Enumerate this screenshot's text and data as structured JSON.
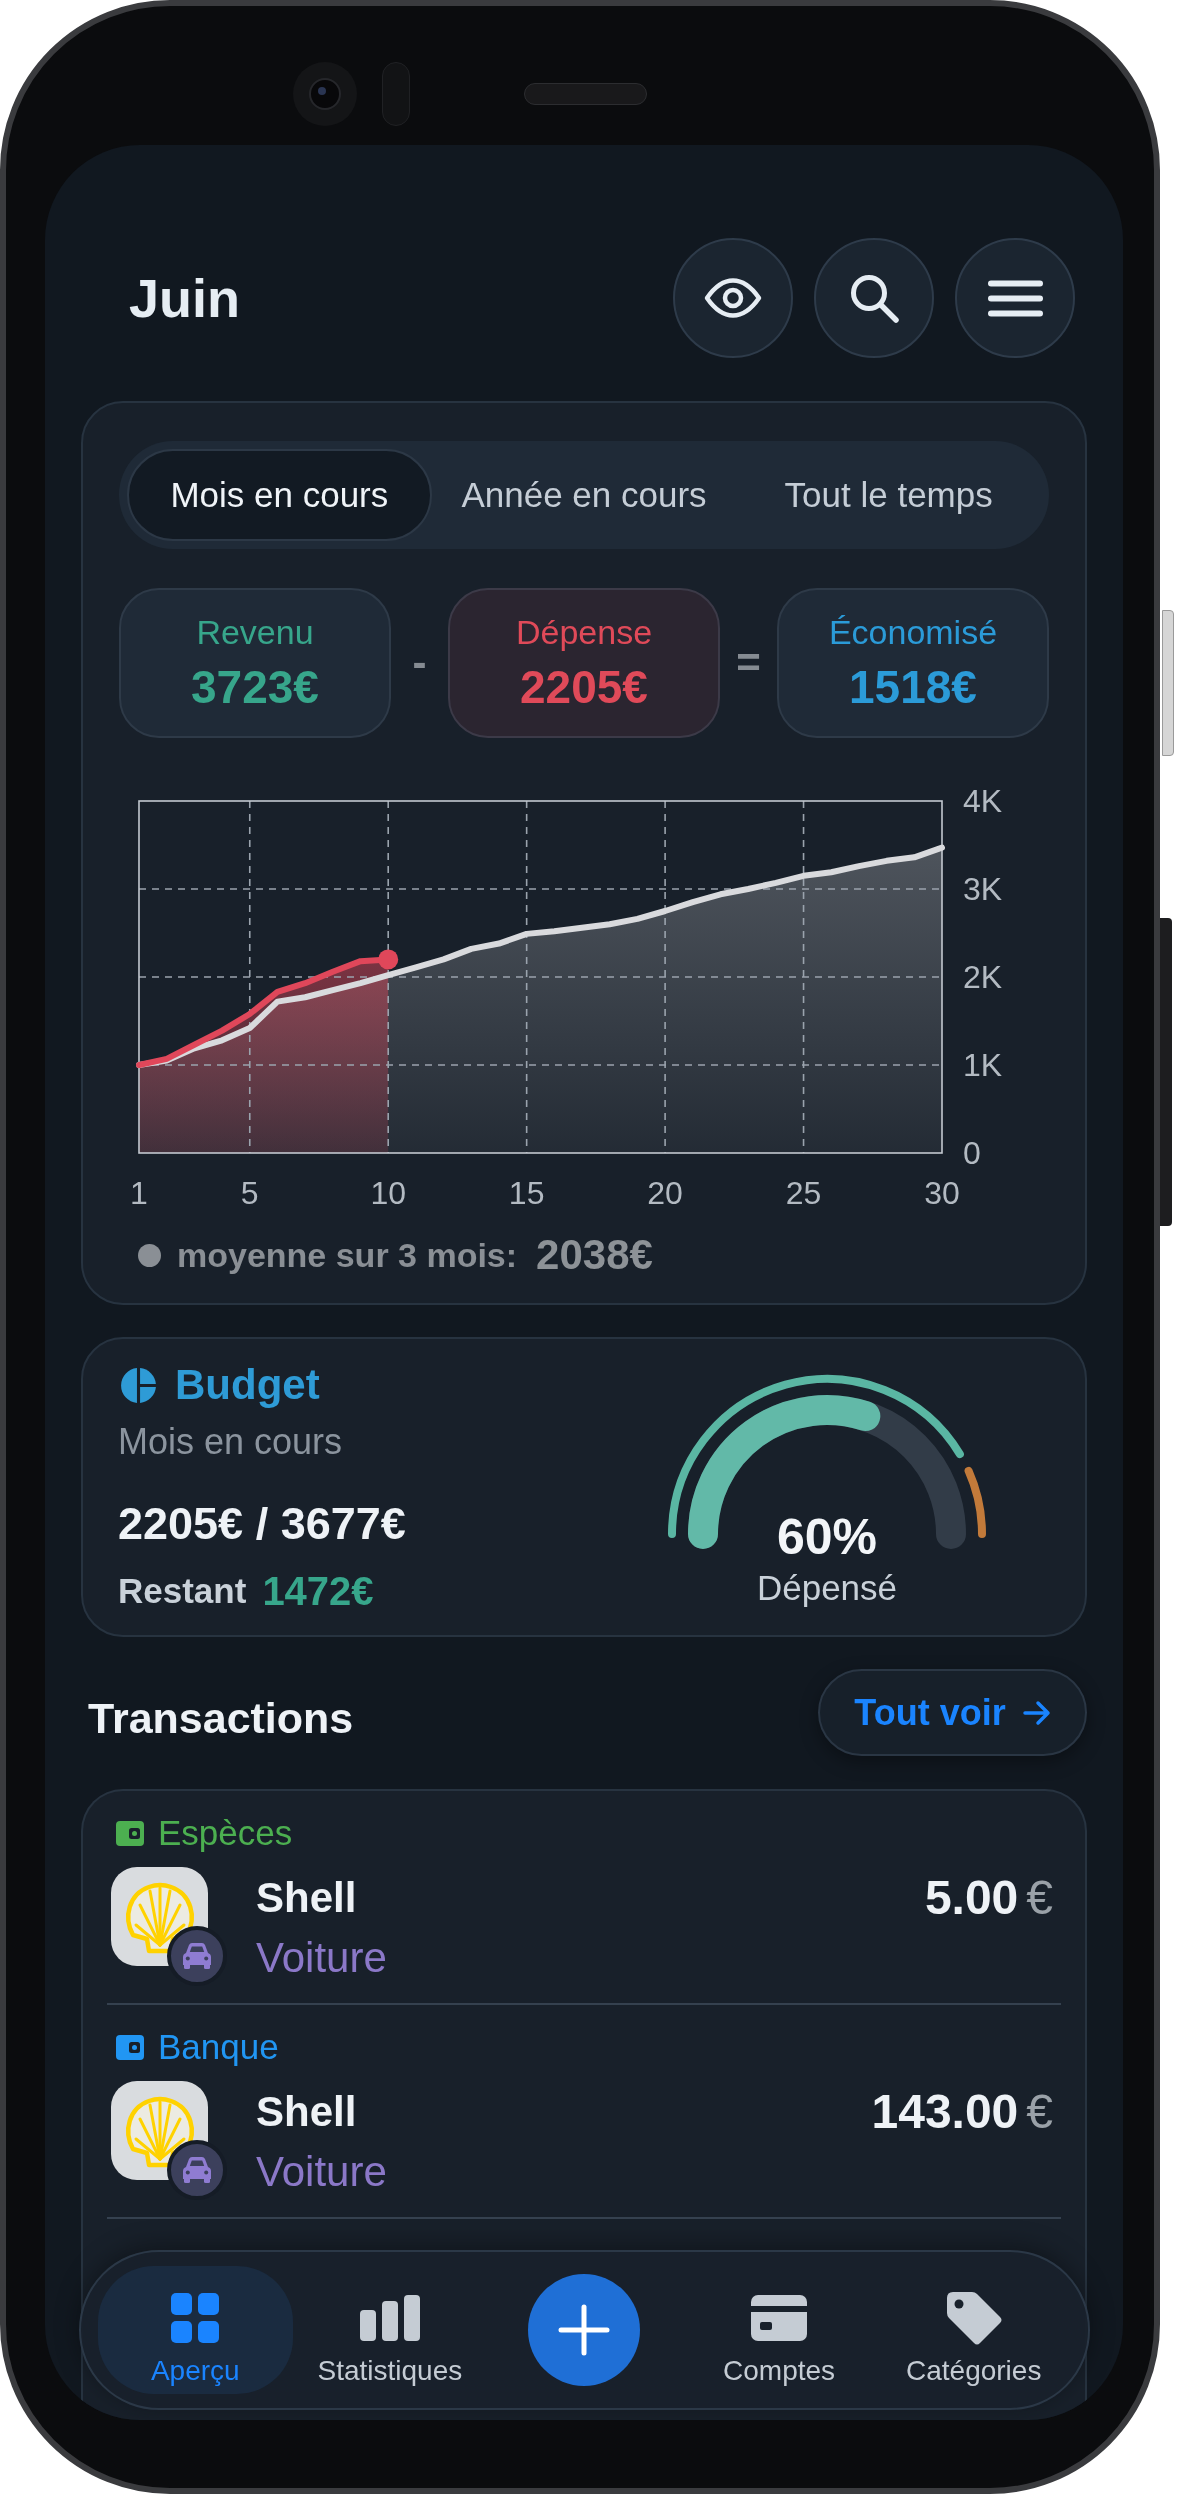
{
  "header": {
    "title": "Juin"
  },
  "overview": {
    "period_tabs": [
      {
        "label": "Mois en cours",
        "selected": true
      },
      {
        "label": "Année en cours",
        "selected": false
      },
      {
        "label": "Tout le temps",
        "selected": false
      }
    ],
    "summary": {
      "cards": [
        {
          "kind": "income",
          "label": "Revenu",
          "value": "3723€",
          "color": "#37a68b"
        },
        {
          "kind": "expense",
          "label": "Dépense",
          "value": "2205€",
          "color": "#e04a59"
        },
        {
          "kind": "savings",
          "label": "Économisé",
          "value": "1518€",
          "color": "#2b9bd8"
        }
      ],
      "operators": [
        "-",
        "="
      ]
    },
    "chart": {
      "chart_data": {
        "type": "area",
        "x": [
          1,
          2,
          3,
          4,
          5,
          6,
          7,
          8,
          9,
          10,
          11,
          12,
          13,
          14,
          15,
          16,
          17,
          18,
          19,
          20,
          21,
          22,
          23,
          24,
          25,
          26,
          27,
          28,
          29,
          30
        ],
        "series": [
          {
            "color": "#e0475a",
            "values": [
              1000,
              1070,
              1230,
              1390,
              1580,
              1830,
              1930,
              2060,
              2180,
              2200,
              null,
              null,
              null,
              null,
              null,
              null,
              null,
              null,
              null,
              null,
              null,
              null,
              null,
              null,
              null,
              null,
              null,
              null,
              null,
              null
            ]
          },
          {
            "color": "#d9dadd",
            "values": [
              1000,
              1050,
              1190,
              1280,
              1420,
              1720,
              1770,
              1850,
              1930,
              2020,
              2110,
              2200,
              2320,
              2380,
              2490,
              2520,
              2560,
              2600,
              2660,
              2750,
              2850,
              2940,
              3000,
              3070,
              3150,
              3190,
              3260,
              3320,
              3360,
              3470
            ]
          }
        ],
        "xlim": [
          1,
          30
        ],
        "ylim": [
          0,
          4000
        ],
        "xticks": [
          1,
          5,
          10,
          15,
          20,
          25,
          30
        ],
        "yticks": [
          {
            "value": 0,
            "label": "0"
          },
          {
            "value": 1000,
            "label": "1K"
          },
          {
            "value": 2000,
            "label": "2K"
          },
          {
            "value": 3000,
            "label": "3K"
          },
          {
            "value": 4000,
            "label": "4K"
          }
        ],
        "grid": true
      },
      "legend": {
        "label": "moyenne sur 3 mois:",
        "value": "2038€"
      }
    }
  },
  "budget": {
    "title": "Budget",
    "period": "Mois en cours",
    "spent": "2205€ / 3677€",
    "remaining_label": "Restant",
    "remaining": "1472€",
    "gauge": {
      "level": 0.6,
      "value": "60%",
      "caption": "Dépensé"
    }
  },
  "transactions": {
    "title": "Transactions",
    "see_all": "Tout voir",
    "groups": [
      {
        "account": "Espèces",
        "color": "#4caf50",
        "items": [
          {
            "merchant": "Shell",
            "category": "Voiture",
            "amount": "5.00",
            "currency": "€"
          }
        ]
      },
      {
        "account": "Banque",
        "color": "#2196f3",
        "items": [
          {
            "merchant": "Shell",
            "category": "Voiture",
            "amount": "143.00",
            "currency": "€"
          }
        ]
      }
    ]
  },
  "bottom_nav": [
    {
      "label": "Aperçu",
      "selected": true
    },
    {
      "label": "Statistiques",
      "selected": false
    },
    {
      "label": "Comptes",
      "selected": false
    },
    {
      "label": "Catégories",
      "selected": false
    }
  ]
}
